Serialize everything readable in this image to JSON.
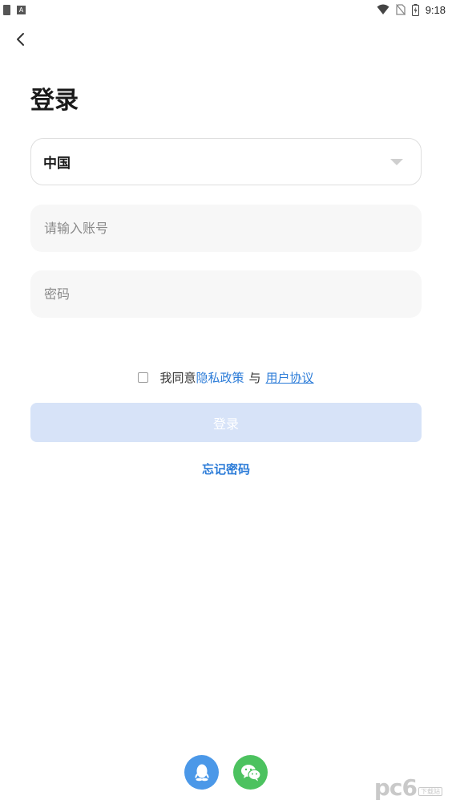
{
  "status_bar": {
    "time": "9:18",
    "notification_icons": [
      "document-icon",
      "a-letter-icon"
    ],
    "system_icons": [
      "wifi-icon",
      "no-sim-icon",
      "battery-charging-icon"
    ]
  },
  "header": {
    "back_icon": "chevron-left-icon",
    "title": "登录"
  },
  "form": {
    "country": {
      "selected": "中国",
      "icon": "caret-down-icon"
    },
    "account": {
      "value": "",
      "placeholder": "请输入账号"
    },
    "password": {
      "value": "",
      "placeholder": "密码"
    }
  },
  "agreement": {
    "checked": false,
    "prefix": "我同意",
    "privacy_link": "隐私政策",
    "separator": "与",
    "terms_link": "用户协议"
  },
  "login_button": {
    "label": "登录",
    "enabled": false
  },
  "forgot_password": "忘记密码",
  "social_login": [
    {
      "name": "qq",
      "icon": "qq-penguin-icon",
      "color": "#4b98e8"
    },
    {
      "name": "wechat",
      "icon": "wechat-icon",
      "color": "#4cc25f"
    }
  ],
  "watermark": {
    "logo": "pc6",
    "sub": "下载站"
  },
  "colors": {
    "accent": "#2c7cd8",
    "login_button_disabled": "#d7e3f8",
    "input_bg": "#f7f7f7"
  }
}
